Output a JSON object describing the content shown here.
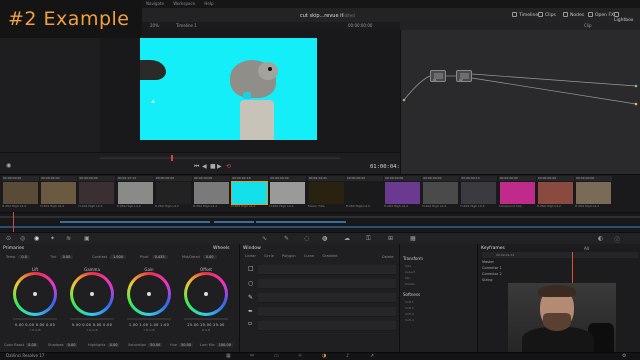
{
  "overlay": {
    "title": "#2   Example"
  },
  "menubar": {
    "items": [
      "Navigate",
      "Workspace",
      "Help"
    ]
  },
  "toolbar": {
    "project_title": "cut skip...revue it",
    "edited": "Edited",
    "buttons": [
      "Timeline",
      "Clips",
      "Nodes",
      "Open FX",
      "Lightbox"
    ]
  },
  "viewer": {
    "header_left": "Timeline 1",
    "header_zoom": "20%",
    "header_tc": "00:00:00:00",
    "timecode": "01:00:04:14"
  },
  "nodes": {
    "header": "Clip",
    "node1_label": "01",
    "node2_label": "02"
  },
  "clips": [
    {
      "num": "01",
      "tc": "00:00:00:00",
      "name": "H.264 High L4.2",
      "color": "#5a4a38"
    },
    {
      "num": "02",
      "tc": "00:00:00:00",
      "name": "H.264 High L4.2",
      "color": "#6a5a40"
    },
    {
      "num": "03",
      "tc": "00:00:00:00",
      "name": "H.264 High L4.2",
      "color": "#3a3032"
    },
    {
      "num": "04",
      "tc": "00:00:12:13",
      "name": "H.264 High L4.2",
      "color": "#8a8a88"
    },
    {
      "num": "05",
      "tc": "00:00:00:00",
      "name": "H.264 High L4.2",
      "color": "#222"
    },
    {
      "num": "06",
      "tc": "00:00:00:00",
      "name": "H.264 High L4.2",
      "color": "#7a7a7a"
    },
    {
      "num": "07",
      "tc": "00:00:02:18",
      "name": "H.264 High L4.2",
      "color": "#14e0ea"
    },
    {
      "num": "08",
      "tc": "00:00:00:00",
      "name": "H.264 High L4.2",
      "color": "#9a9a98"
    },
    {
      "num": "09",
      "tc": "00:00:14:21",
      "name": "Fusion Title",
      "color": "#2a2210"
    },
    {
      "num": "10",
      "tc": "00:00:00:00",
      "name": "H.264 High L4.2",
      "color": "#1a1a1a"
    },
    {
      "num": "11",
      "tc": "00:00:00:00",
      "name": "H.264 High L4.2",
      "color": "#6a3a90"
    },
    {
      "num": "12",
      "tc": "00:00:00:00",
      "name": "H.264 High L4.2",
      "color": "#4a4a4a"
    },
    {
      "num": "13",
      "tc": "00:00:00:13",
      "name": "H.264 High L4.2",
      "color": "#3a3a40"
    },
    {
      "num": "14",
      "tc": "00:00:00:00",
      "name": "Compound Clip",
      "color": "#c02a8a"
    },
    {
      "num": "15",
      "tc": "00:00:00:00",
      "name": "H.264 High L4.2",
      "color": "#8a4a40"
    },
    {
      "num": "16",
      "tc": "00:00:00:00",
      "name": "H.264 High L4.2",
      "color": "#7a6a58"
    },
    {
      "num": "17",
      "tc": "00:00:00:00",
      "name": "H.264 High L4.2",
      "color": "#9a8a70"
    }
  ],
  "primaries": {
    "title": "Primaries",
    "wheels_title": "Wheels",
    "fields": [
      {
        "label": "Temp",
        "value": "0.0"
      },
      {
        "label": "Tint",
        "value": "0.00"
      },
      {
        "label": "Contrast",
        "value": "1.000"
      },
      {
        "label": "Pivot",
        "value": "0.435"
      },
      {
        "label": "Mid/Detail",
        "value": "0.00"
      }
    ],
    "wheels": [
      {
        "name": "Lift",
        "vals": "0.00  0.00  0.00  0.00",
        "rgb": "Y  R  G  B"
      },
      {
        "name": "Gamma",
        "vals": "0.00  0.00  0.00  0.00",
        "rgb": "Y  R  G  B"
      },
      {
        "name": "Gain",
        "vals": "1.00  1.00  1.00  1.00",
        "rgb": "Y  R  G  B"
      },
      {
        "name": "Offset",
        "vals": "25.00  25.00  25.00",
        "rgb": "R  G  B"
      }
    ],
    "bottom": [
      {
        "label": "Color Boost",
        "value": "0.00"
      },
      {
        "label": "Shadows",
        "value": "0.00"
      },
      {
        "label": "Highlights",
        "value": "0.00"
      },
      {
        "label": "Saturation",
        "value": "50.00"
      },
      {
        "label": "Hue",
        "value": "50.00"
      },
      {
        "label": "Lum Mix",
        "value": "100.00"
      }
    ]
  },
  "window": {
    "title": "Window",
    "tools": [
      "Linear",
      "Circle",
      "Polygon",
      "Curve",
      "Gradient"
    ],
    "delete": "Delete"
  },
  "transform": {
    "title": "Transform",
    "rows": [
      "Size",
      "Aspect",
      "Pan",
      "Rotate"
    ],
    "softness_title": "Softness",
    "softness_rows": [
      "Soft 1",
      "Soft 2",
      "Soft 3",
      "Soft 4"
    ]
  },
  "keyframes": {
    "title": "Keyframes",
    "all": "All",
    "ruler": "00:00:04:14",
    "rows": [
      "Master",
      "Corrector 1",
      "Corrector 2",
      "Sizing"
    ]
  },
  "statusbar": {
    "app": "DaVinci Resolve 17"
  },
  "colors": {
    "accent": "#e09a35",
    "playhead": "#d84545",
    "screen": "#14eef8"
  }
}
